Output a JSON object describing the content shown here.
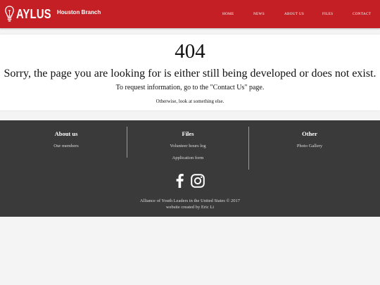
{
  "brand": {
    "name": "AYLUS",
    "branch": "Houston Branch"
  },
  "nav": {
    "home": "HOME",
    "news": "NEWS",
    "about": "ABOUT US",
    "files": "FILES",
    "contact": "CONTACT"
  },
  "error": {
    "code": "404",
    "message": "Sorry, the page you are looking for is either still being developed or does not exist.",
    "info": "To request information, go to the \"Contact Us\" page.",
    "other": "Otherwise, look at something else."
  },
  "footer": {
    "about": {
      "title": "About us",
      "links": [
        "Our members"
      ]
    },
    "files": {
      "title": "Files",
      "links": [
        "Volunteer hours log",
        "Application form"
      ]
    },
    "other": {
      "title": "Other",
      "links": [
        "Photo Gallery"
      ]
    },
    "copyright": "Alliance of Youth Leaders in the United States © 2017",
    "credit": "website created by Eric Li"
  },
  "icons": {
    "logo": "lightbulb-icon",
    "facebook": "facebook-icon",
    "instagram": "instagram-icon"
  },
  "colors": {
    "navbar": "#c41f24",
    "footer": "#3a3a3a",
    "page": "#f4f4f4"
  }
}
